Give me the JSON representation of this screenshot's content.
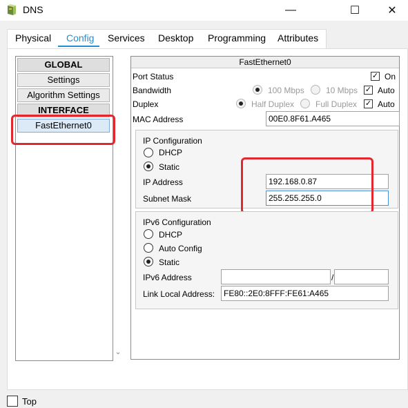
{
  "window": {
    "title": "DNS",
    "icon": "router-icon",
    "minimize": "—",
    "maximize": "☐",
    "close": "✕"
  },
  "tabs": [
    {
      "label": "Physical"
    },
    {
      "label": "Config",
      "active": true
    },
    {
      "label": "Services"
    },
    {
      "label": "Desktop"
    },
    {
      "label": "Programming"
    },
    {
      "label": "Attributes"
    }
  ],
  "sidebar": {
    "global_header": "GLOBAL",
    "settings": "Settings",
    "algorithm_settings": "Algorithm Settings",
    "interface_header": "INTERFACE",
    "selected_interface": "FastEthernet0"
  },
  "panel": {
    "title": "FastEthernet0",
    "port_status_label": "Port Status",
    "port_status_on_label": "On",
    "port_status_on": true,
    "bandwidth_label": "Bandwidth",
    "bandwidth_100": "100 Mbps",
    "bandwidth_10": "10 Mbps",
    "bandwidth_auto_label": "Auto",
    "bandwidth_auto": true,
    "duplex_label": "Duplex",
    "duplex_half": "Half Duplex",
    "duplex_full": "Full Duplex",
    "duplex_auto_label": "Auto",
    "duplex_auto": true,
    "mac_label": "MAC Address",
    "mac_value": "00E0.8F61.A465"
  },
  "ipv4": {
    "title": "IP Configuration",
    "dhcp_label": "DHCP",
    "static_label": "Static",
    "mode": "Static",
    "ip_label": "IP Address",
    "ip_value": "192.168.0.87",
    "mask_label": "Subnet Mask",
    "mask_value": "255.255.255.0"
  },
  "ipv6": {
    "title": "IPv6 Configuration",
    "dhcp_label": "DHCP",
    "auto_label": "Auto Config",
    "static_label": "Static",
    "mode": "Static",
    "address_label": "IPv6 Address",
    "address_value": "",
    "prefix_separator": "/",
    "prefix_value": "",
    "link_local_label": "Link Local Address:",
    "link_local_value": "FE80::2E0:8FFF:FE61:A465"
  },
  "footer": {
    "top_label": "Top",
    "top_checked": false
  },
  "colors": {
    "accent": "#1e90d0",
    "highlight": "#e0282e",
    "selection": "#dce9f7"
  }
}
